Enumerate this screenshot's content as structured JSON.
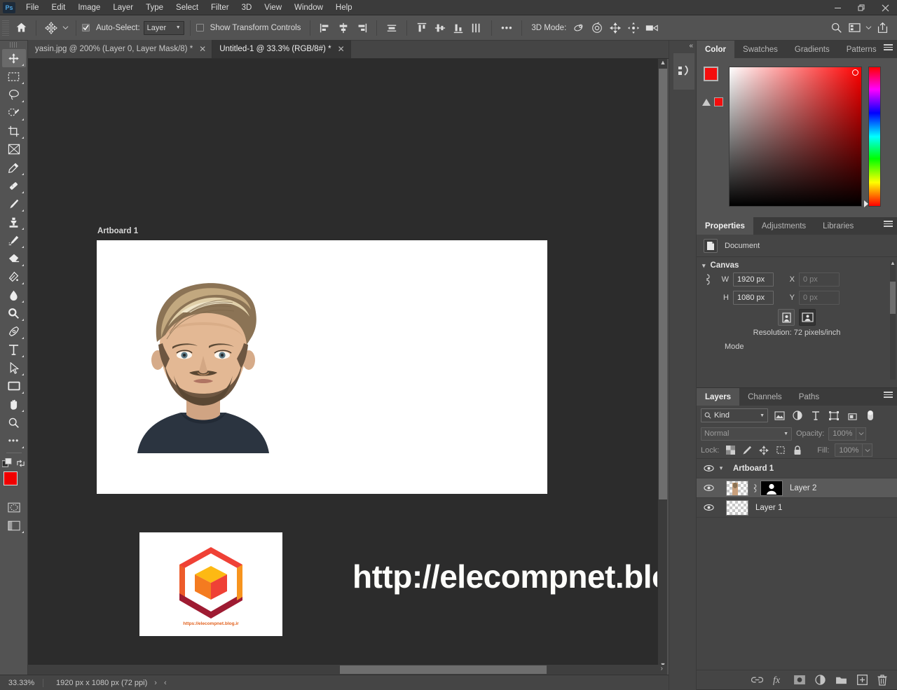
{
  "app": {
    "name": "Adobe Photoshop",
    "logo_text": "Ps"
  },
  "menubar": {
    "items": [
      "File",
      "Edit",
      "Image",
      "Layer",
      "Type",
      "Select",
      "Filter",
      "3D",
      "View",
      "Window",
      "Help"
    ]
  },
  "window_controls": {
    "minimize": "—",
    "restore": "❐",
    "close": "✕"
  },
  "options_bar": {
    "home_icon": "home-icon",
    "tool_icon": "move-tool-icon",
    "auto_select_label": "Auto-Select:",
    "auto_select_checked": true,
    "auto_select_target": "Layer",
    "show_transform_label": "Show Transform Controls",
    "show_transform_checked": false,
    "align_icons": [
      "align-left-edges",
      "align-horizontal-centers",
      "align-right-edges",
      "distribute-horizontally",
      "align-top-edges",
      "align-vertical-centers",
      "align-bottom-edges",
      "distribute-vertically"
    ],
    "more_label": "•••",
    "three_d_mode_label": "3D Mode:",
    "three_d_icons": [
      "orbit-3d-icon",
      "roll-3d-icon",
      "pan-3d-icon",
      "slide-3d-icon",
      "camera-3d-icon"
    ],
    "right_icons": [
      "search-icon",
      "workspace-icon",
      "share-icon"
    ]
  },
  "tabs": [
    {
      "label": "yasin.jpg @ 200% (Layer 0, Layer Mask/8) *",
      "active": false,
      "close": "✕"
    },
    {
      "label": "Untitled-1 @ 33.3% (RGB/8#) *",
      "active": true,
      "close": "✕"
    }
  ],
  "toolbar": {
    "tools": [
      {
        "name": "move-tool",
        "active": true
      },
      {
        "name": "rectangular-marquee-tool",
        "active": false
      },
      {
        "name": "lasso-tool",
        "active": false
      },
      {
        "name": "object-selection-tool",
        "active": false
      },
      {
        "name": "crop-tool",
        "active": false
      },
      {
        "name": "frame-tool",
        "active": false
      },
      {
        "name": "eyedropper-tool",
        "active": false
      },
      {
        "name": "spot-healing-brush-tool",
        "active": false
      },
      {
        "name": "brush-tool",
        "active": false
      },
      {
        "name": "clone-stamp-tool",
        "active": false
      },
      {
        "name": "history-brush-tool",
        "active": false
      },
      {
        "name": "eraser-tool",
        "active": false
      },
      {
        "name": "gradient-tool",
        "active": false
      },
      {
        "name": "blur-tool",
        "active": false
      },
      {
        "name": "dodge-tool",
        "active": false
      },
      {
        "name": "pen-tool",
        "active": false
      },
      {
        "name": "type-tool",
        "active": false
      },
      {
        "name": "path-selection-tool",
        "active": false
      },
      {
        "name": "rectangle-tool",
        "active": false
      },
      {
        "name": "hand-tool",
        "active": false
      },
      {
        "name": "zoom-tool",
        "active": false
      },
      {
        "name": "edit-toolbar-more",
        "active": false
      }
    ],
    "foreground_color": "#f40d0d",
    "background_color": "#ffffff",
    "quick_mask_name": "quick-mask-icon",
    "screen_mode_name": "screen-mode-icon"
  },
  "canvas": {
    "artboard_label": "Artboard 1",
    "watermark_text": "http://elecompnet.blog.ir",
    "logo_url_text": "https://elecompnet.blog.ir",
    "background_color": "#2c2c2c",
    "artboard_color": "#ffffff"
  },
  "statusbar": {
    "zoom": "33.33%",
    "doc_size": "1920 px x 1080 px (72 ppi)",
    "arrow_right": "›",
    "arrow_left": "‹"
  },
  "color_panel": {
    "tabs": [
      "Color",
      "Swatches",
      "Gradients",
      "Patterns"
    ],
    "active_tab": "Color",
    "foreground": "#f40d0d",
    "background": "#ffffff",
    "warning_color": "#f40d0d"
  },
  "properties_panel": {
    "tabs": [
      "Properties",
      "Adjustments",
      "Libraries"
    ],
    "active_tab": "Properties",
    "doc_type": "Document",
    "section_title": "Canvas",
    "width_label": "W",
    "width_value": "1920 px",
    "height_label": "H",
    "height_value": "1080 px",
    "x_label": "X",
    "x_value": "0 px",
    "y_label": "Y",
    "y_value": "0 px",
    "resolution_text": "Resolution: 72 pixels/inch",
    "mode_label": "Mode"
  },
  "layers_panel": {
    "tabs": [
      "Layers",
      "Channels",
      "Paths"
    ],
    "active_tab": "Layers",
    "filter_label": "Kind",
    "filter_icons": [
      "pixel-filter-icon",
      "adjustment-filter-icon",
      "type-filter-icon",
      "shape-filter-icon",
      "smart-object-filter-icon"
    ],
    "blend_mode": "Normal",
    "opacity_label": "Opacity:",
    "opacity_value": "100%",
    "lock_label": "Lock:",
    "lock_icons": [
      "lock-transparent-pixels-icon",
      "lock-image-pixels-icon",
      "lock-position-icon",
      "lock-artboard-nesting-icon",
      "lock-all-icon"
    ],
    "fill_label": "Fill:",
    "fill_value": "100%",
    "layers": [
      {
        "name": "Artboard 1",
        "type": "group",
        "visible": true,
        "selected": false
      },
      {
        "name": "Layer 2",
        "type": "image-with-mask",
        "visible": true,
        "selected": true
      },
      {
        "name": "Layer 1",
        "type": "image",
        "visible": true,
        "selected": false
      }
    ],
    "footer_icons": [
      "link-layers-icon",
      "layer-style-fx-icon",
      "add-layer-mask-icon",
      "new-adjustment-layer-icon",
      "new-group-icon",
      "new-layer-icon",
      "delete-layer-icon"
    ]
  }
}
